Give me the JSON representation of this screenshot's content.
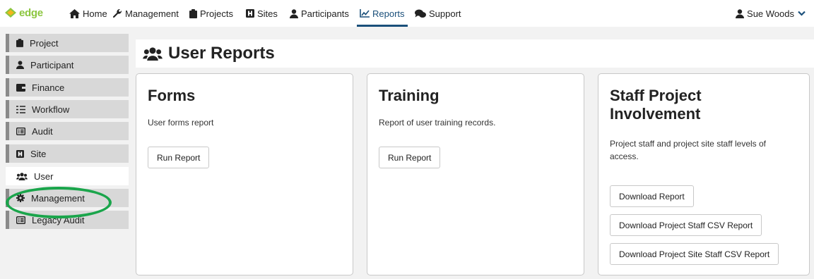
{
  "nav": {
    "logo_text": "edge",
    "logo_badge": "",
    "items": [
      {
        "label": "Home",
        "icon": "home-icon"
      },
      {
        "label": "Management",
        "icon": "wrench-icon"
      },
      {
        "label": "Projects",
        "icon": "clipboard-icon"
      },
      {
        "label": "Sites",
        "icon": "hospital-icon"
      },
      {
        "label": "Participants",
        "icon": "person-icon"
      },
      {
        "label": "Reports",
        "icon": "line-chart-icon",
        "active": true
      },
      {
        "label": "Support",
        "icon": "comments-icon"
      }
    ],
    "user_name": "Sue Woods"
  },
  "sidebar": {
    "items": [
      {
        "label": "Project",
        "icon": "clipboard-icon"
      },
      {
        "label": "Participant",
        "icon": "person-icon"
      },
      {
        "label": "Finance",
        "icon": "wallet-icon"
      },
      {
        "label": "Workflow",
        "icon": "list-ol-icon"
      },
      {
        "label": "Audit",
        "icon": "list-alt-icon"
      },
      {
        "label": "Site",
        "icon": "hospital-icon"
      },
      {
        "label": "User",
        "icon": "users-icon",
        "active": true
      },
      {
        "label": "Management",
        "icon": "cog-icon"
      },
      {
        "label": "Legacy Audit",
        "icon": "list-alt-icon"
      }
    ],
    "highlight_color": "#1aa54b"
  },
  "main": {
    "title": "User Reports",
    "cards": [
      {
        "title_lines": [
          "Forms"
        ],
        "description": "User forms report",
        "buttons": [
          "Run Report"
        ]
      },
      {
        "title_lines": [
          "Training"
        ],
        "description": "Report of user training records.",
        "buttons": [
          "Run Report"
        ]
      },
      {
        "title_lines": [
          "Staff Project",
          "Involvement"
        ],
        "description_lines": [
          "Project staff and project site staff levels of",
          "access."
        ],
        "buttons": [
          "Download Report",
          "Download Project Staff CSV Report",
          "Download Project Site Staff CSV Report"
        ]
      }
    ]
  },
  "colors": {
    "accent": "#1a4f7a",
    "logo": "#8cc63f",
    "sidebar_item_bg": "#d8d8d8",
    "sidebar_border": "#8a8a8a"
  }
}
